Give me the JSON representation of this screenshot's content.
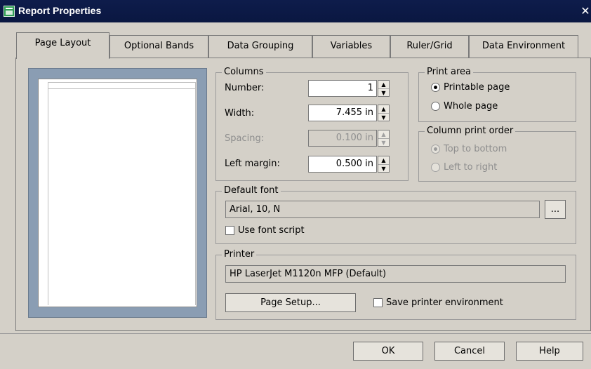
{
  "window": {
    "title": "Report Properties",
    "close_glyph": "✕"
  },
  "tabs": [
    "Page Layout",
    "Optional Bands",
    "Data Grouping",
    "Variables",
    "Ruler/Grid",
    "Data Environment"
  ],
  "columns": {
    "legend": "Columns",
    "number_label": "Number:",
    "number_value": "1",
    "width_label": "Width:",
    "width_value": "7.455 in",
    "spacing_label": "Spacing:",
    "spacing_value": "0.100 in",
    "left_margin_label": "Left margin:",
    "left_margin_value": "0.500 in"
  },
  "print_area": {
    "legend": "Print area",
    "printable": "Printable page",
    "whole": "Whole page",
    "selected": "printable"
  },
  "column_order": {
    "legend": "Column print order",
    "top_bottom": "Top to bottom",
    "left_right": "Left to right",
    "selected": "top_bottom"
  },
  "default_font": {
    "legend": "Default font",
    "value": "Arial, 10, N",
    "browse": "...",
    "use_script": "Use font script"
  },
  "printer": {
    "legend": "Printer",
    "value": "HP LaserJet M1120n MFP (Default)",
    "page_setup": "Page Setup...",
    "save_env": "Save printer environment"
  },
  "footer": {
    "ok": "OK",
    "cancel": "Cancel",
    "help": "Help"
  },
  "colors": {
    "titlebar": "#0a1741",
    "dialog": "#d4d0c8",
    "preview_bg": "#8a9db3"
  }
}
